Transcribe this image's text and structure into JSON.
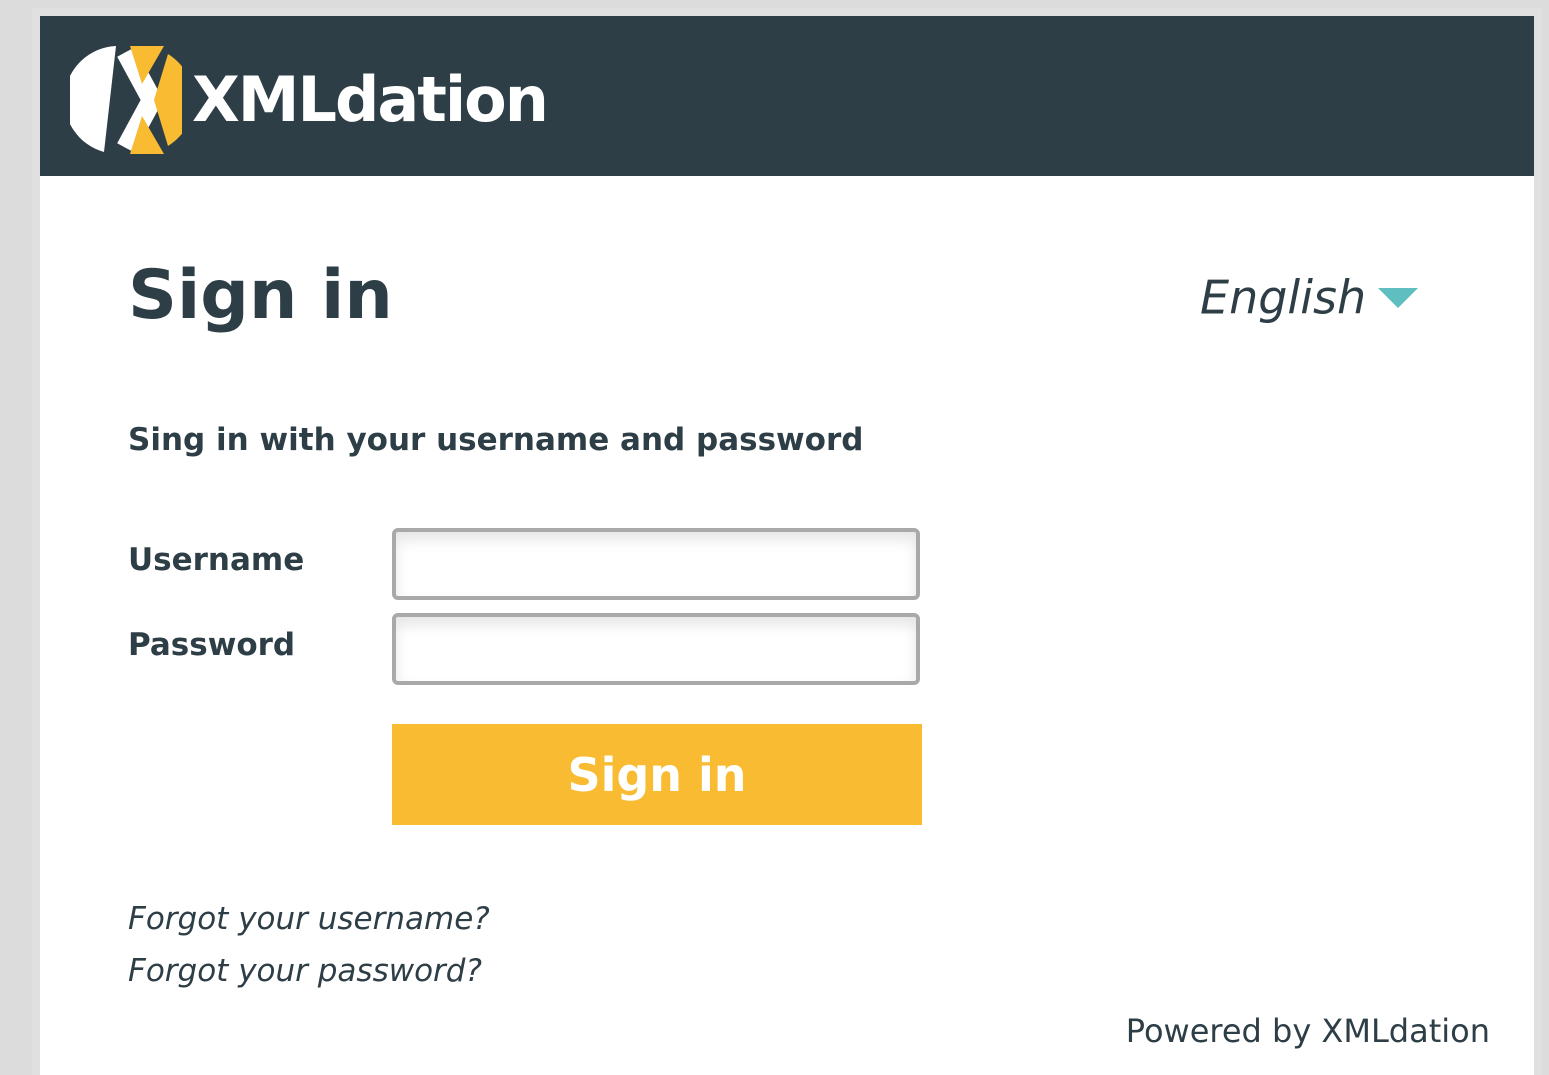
{
  "header": {
    "brand": "XMLdation",
    "logo_icon": "xmldation-x-logo-icon"
  },
  "login": {
    "title": "Sign in",
    "language": "English",
    "subtitle": "Sing in with your username and password",
    "username_label": "Username",
    "username_value": "",
    "password_label": "Password",
    "password_value": "",
    "submit_label": "Sign in",
    "forgot_username": "Forgot your username?",
    "forgot_password": "Forgot your password?"
  },
  "footer": {
    "powered_by": "Powered by XMLdation"
  },
  "colors": {
    "header_bg": "#2e3e46",
    "accent_yellow": "#f8bb32",
    "caret_teal": "#5fbfc0",
    "text_dark": "#2e3e46"
  }
}
